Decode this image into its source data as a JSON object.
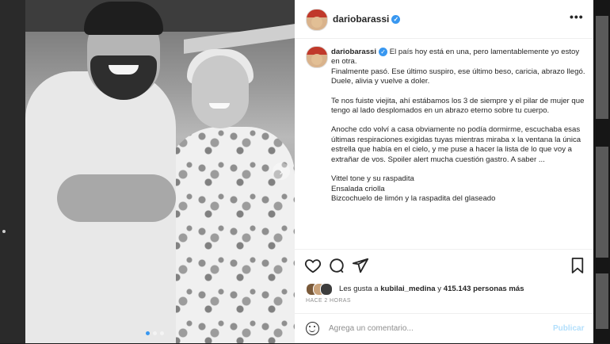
{
  "post": {
    "username": "dariobarassi",
    "more_label": "•••",
    "caption": {
      "username": "dariobarassi",
      "p1": "El país hoy está en una, pero lamentablemente yo estoy en otra.",
      "p1b": "Finalmente pasó. Ese último suspiro, ese último beso, caricia, abrazo llegó. Duele, alivia y vuelve a doler.",
      "p2": "Te nos fuiste viejita, ahí estábamos los 3 de siempre y el pilar de mujer que tengo al lado desplomados en un abrazo eterno sobre tu cuerpo.",
      "p3": "Anoche cdo volví a casa obviamente no podía dormirme, escuchaba esas últimas respiraciones exigidas tuyas mientras miraba x la ventana la única estrella que había en el cielo, y me puse a hacer la lista de lo que voy a extrañar de vos. Spoiler alert mucha cuestión gastro. A saber ...",
      "list": [
        "Vittel tone y su raspadita",
        "Ensalada criolla",
        "Bizcochuelo de limón y la raspadita del glaseado"
      ]
    },
    "likes": {
      "prefix": "Les gusta a",
      "user": "kubilai_medina",
      "middle": "y",
      "count": "415.143 personas más"
    },
    "time_ago": "HACE 2 HORAS",
    "comment": {
      "placeholder": "Agrega un comentario...",
      "publish": "Publicar"
    },
    "colors": {
      "accent": "#3897f0",
      "publish_disabled": "#b2dffc"
    }
  },
  "photo": {
    "carousel_next_icon": "chevron-right-icon",
    "slides": 3,
    "active_slide": 1
  }
}
